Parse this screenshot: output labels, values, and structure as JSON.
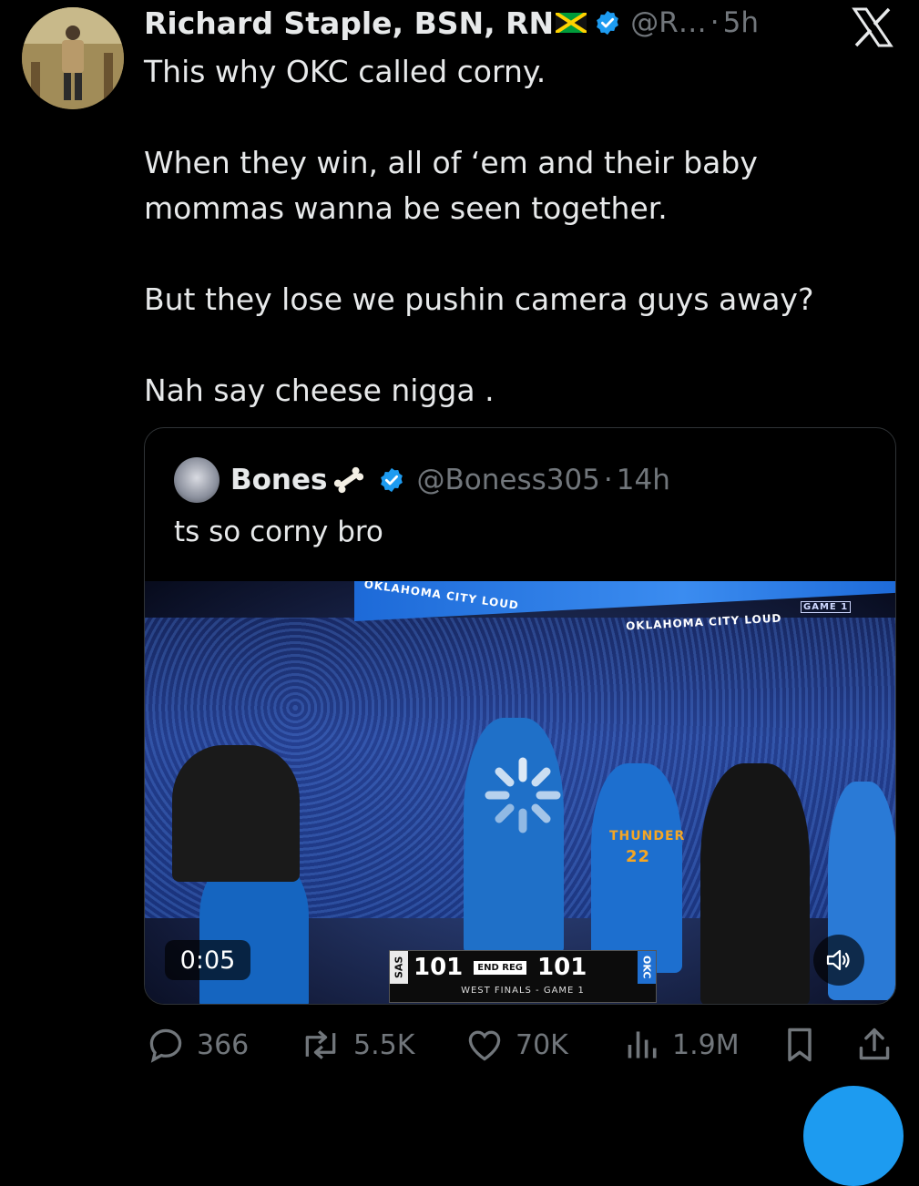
{
  "tweet": {
    "author_name": "Richard Staple, BSN, RN",
    "handle": "@R…",
    "separator": "·",
    "time": "5h",
    "text": "This why OKC called corny.\n\nWhen they win, all of ‘em and their baby mommas wanna be seen together.\n\nBut they lose we pushin camera guys away?\n\nNah say cheese nigga ."
  },
  "quoted_tweet": {
    "author_name": "Bones",
    "handle": "@Boness305",
    "separator": "·",
    "time": "14h",
    "text": "ts so corny bro",
    "video": {
      "duration": "0:05",
      "banner_text_left": "OKLAHOMA CITY LOUD",
      "banner_text_right": "OKLAHOMA CITY LOUD",
      "game_label": "GAME 1",
      "jersey_text": "THUNDER",
      "jersey_number": "22",
      "scorebug": {
        "away_team": "SAS",
        "away_score": "101",
        "status": "END REG",
        "home_score": "101",
        "home_team": "OKC",
        "subtitle": "WEST FINALS - GAME 1"
      }
    }
  },
  "engagement": {
    "replies": "366",
    "reposts": "5.5K",
    "likes": "70K",
    "views": "1.9M"
  },
  "icons": {
    "verified": "verified-badge-icon",
    "x_logo": "x-logo-icon",
    "reply": "reply-icon",
    "repost": "repost-icon",
    "like": "heart-icon",
    "views": "views-icon",
    "bookmark": "bookmark-icon",
    "share": "share-icon"
  },
  "colors": {
    "background": "#000000",
    "text": "#e7e9ea",
    "secondary": "#71767b",
    "verified_blue": "#1d9bf0"
  }
}
